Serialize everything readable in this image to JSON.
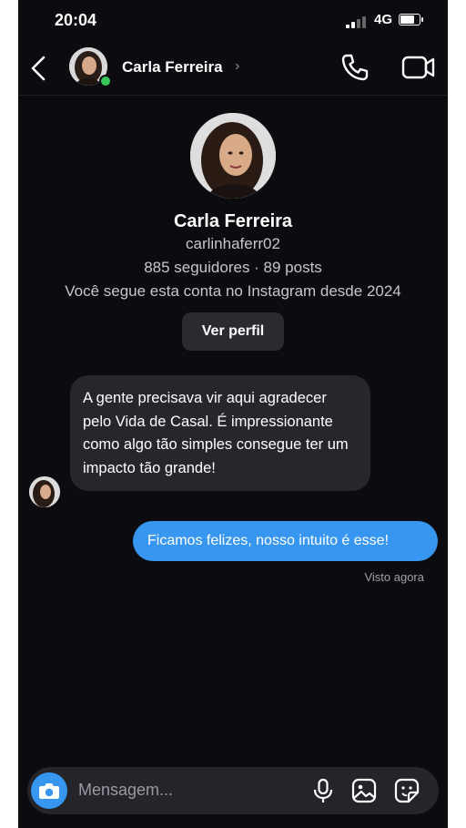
{
  "status_bar": {
    "time": "20:04",
    "network": "4G"
  },
  "header": {
    "contact_name": "Carla Ferreira",
    "online": true
  },
  "profile": {
    "name": "Carla Ferreira",
    "username": "carlinhaferr02",
    "stats": "885 seguidores · 89 posts",
    "follow_since": "Você segue esta conta no Instagram desde 2024",
    "view_profile_label": "Ver perfil"
  },
  "messages": [
    {
      "direction": "incoming",
      "text": "A gente precisava vir aqui agradecer pelo Vida de Casal. É impressionante como algo tão simples consegue ter um impacto tão grande!"
    },
    {
      "direction": "outgoing",
      "text": "Ficamos felizes, nosso intuito é esse!"
    }
  ],
  "seen_status": "Visto agora",
  "composer": {
    "placeholder": "Mensagem..."
  },
  "colors": {
    "accent": "#3797f0",
    "background": "#0b0b10",
    "bubble_incoming": "#26262c",
    "online": "#35c759"
  },
  "icons": [
    "back-arrow-icon",
    "phone-call-icon",
    "video-call-icon",
    "camera-icon",
    "microphone-icon",
    "gallery-icon",
    "sticker-icon"
  ]
}
